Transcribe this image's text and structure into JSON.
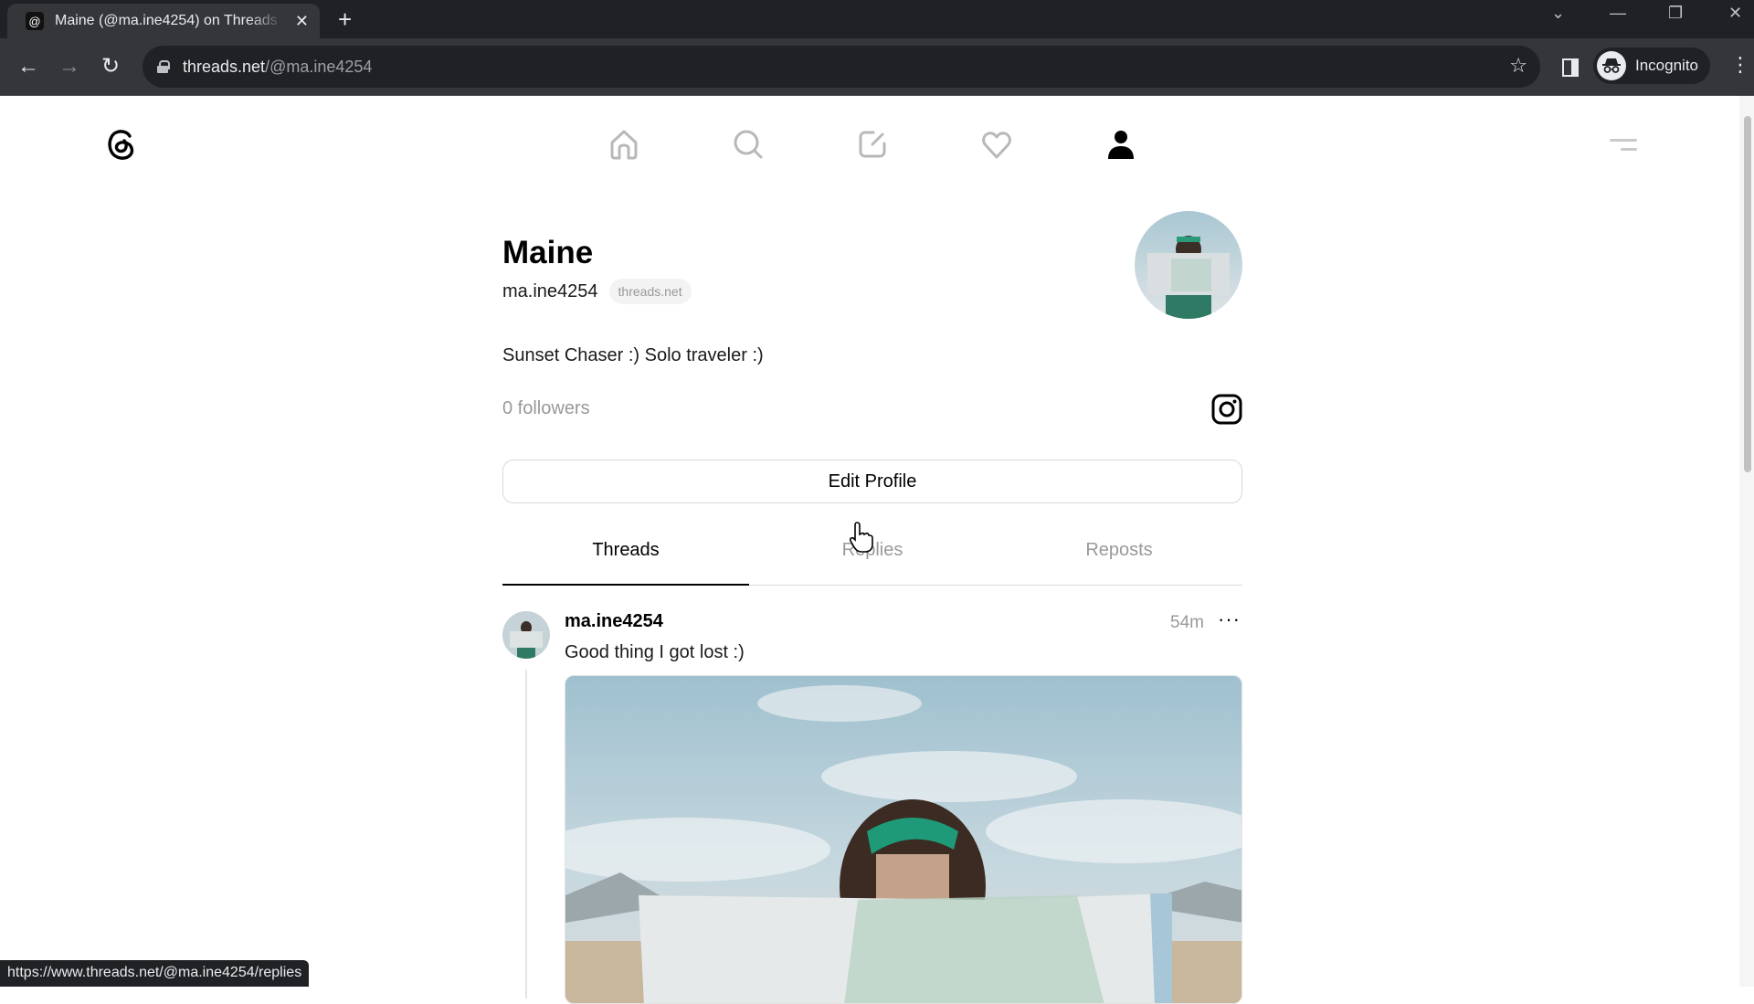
{
  "browser": {
    "tab_title": "Maine (@ma.ine4254) on Threads",
    "tab_close": "✕",
    "new_tab": "+",
    "url_host": "threads.net",
    "url_path": "/@ma.ine4254",
    "incognito_label": "Incognito",
    "window_controls": {
      "tab_search": "⌄",
      "minimize": "—",
      "restore": "❐",
      "close": "✕"
    },
    "nav": {
      "back": "←",
      "forward": "→",
      "reload": "↻"
    },
    "bookmark_star": "☆",
    "menu": "⋮",
    "status_url": "https://www.threads.net/@ma.ine4254/replies"
  },
  "threads_nav": {
    "items": [
      {
        "name": "home",
        "icon": "home-icon",
        "active": false
      },
      {
        "name": "search",
        "icon": "search-icon",
        "active": false
      },
      {
        "name": "create",
        "icon": "compose-icon",
        "active": false
      },
      {
        "name": "activity",
        "icon": "heart-icon",
        "active": false
      },
      {
        "name": "profile",
        "icon": "user-icon",
        "active": true
      }
    ]
  },
  "profile": {
    "display_name": "Maine",
    "handle": "ma.ine4254",
    "domain_badge": "threads.net",
    "bio": "Sunset Chaser :) Solo traveler :)",
    "followers": "0 followers",
    "edit_button": "Edit Profile"
  },
  "tabs": [
    {
      "label": "Threads",
      "active": true
    },
    {
      "label": "Replies",
      "active": false
    },
    {
      "label": "Reposts",
      "active": false
    }
  ],
  "posts": [
    {
      "username": "ma.ine4254",
      "time": "54m",
      "more": "···",
      "text": "Good thing I got lost :)",
      "image_alt": "Woman with green headband holding an open map in front of her face, sky and mountains behind"
    }
  ],
  "colors": {
    "chrome_dark": "#202124",
    "chrome_toolbar": "#35363a",
    "text_primary": "#000000",
    "text_secondary": "#999999",
    "nav_inactive": "#b8b8b8"
  }
}
